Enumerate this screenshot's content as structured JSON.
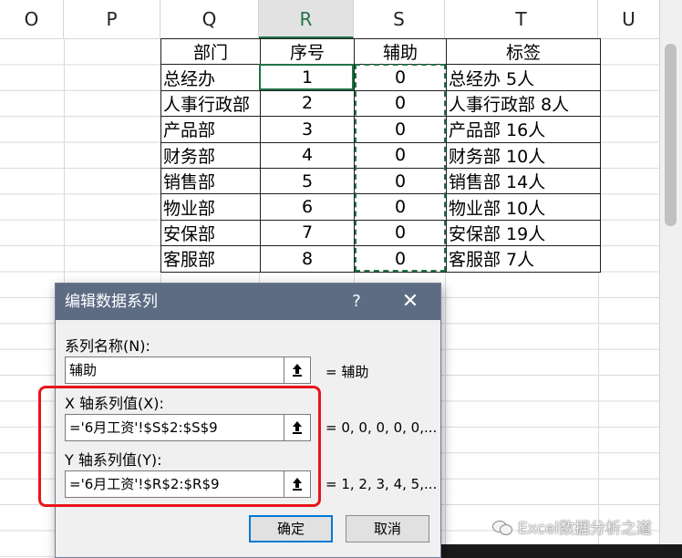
{
  "columns": [
    "O",
    "P",
    "Q",
    "R",
    "S",
    "T",
    "U"
  ],
  "selected_column": "R",
  "table": {
    "headers": [
      "部门",
      "序号",
      "辅助",
      "标签"
    ],
    "rows": [
      [
        "总经办",
        "1",
        "0",
        "总经办  5人"
      ],
      [
        "人事行政部",
        "2",
        "0",
        "人事行政部  8人"
      ],
      [
        "产品部",
        "3",
        "0",
        "产品部  16人"
      ],
      [
        "财务部",
        "4",
        "0",
        "财务部  10人"
      ],
      [
        "销售部",
        "5",
        "0",
        "销售部  14人"
      ],
      [
        "物业部",
        "6",
        "0",
        "物业部  10人"
      ],
      [
        "安保部",
        "7",
        "0",
        "安保部  19人"
      ],
      [
        "客服部",
        "8",
        "0",
        "客服部  7人"
      ]
    ]
  },
  "dialog": {
    "title": "编辑数据系列",
    "help_label": "?",
    "close_label": "✕",
    "series_name_label": "系列名称(N):",
    "series_name_value": "辅助",
    "series_name_eval": "= 辅助",
    "x_label": "X 轴系列值(X):",
    "x_value": "='6月工资'!$S$2:$S$9",
    "x_eval": "= 0, 0, 0, 0, 0,...",
    "y_label": "Y 轴系列值(Y):",
    "y_value": "='6月工资'!$R$2:$R$9",
    "y_eval": "= 1, 2, 3, 4, 5,...",
    "ok_label": "确定",
    "cancel_label": "取消"
  },
  "watermark": "Excel数据分析之道",
  "colors": {
    "dialog_titlebar": "#5d6c83",
    "selection_green": "#217346",
    "highlight_red": "#e8141b",
    "primary_button_border": "#0078d7"
  }
}
